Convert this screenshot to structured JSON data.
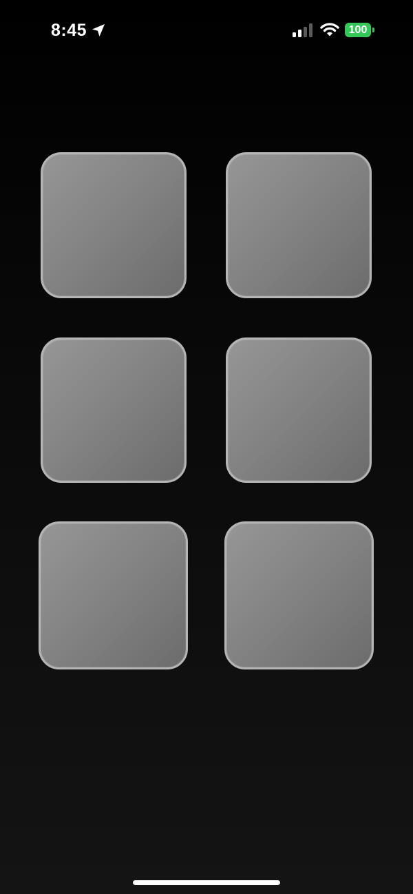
{
  "status_bar": {
    "time": "8:45",
    "battery_level": "100",
    "icons": [
      "location-arrow-icon",
      "cellular-signal-icon",
      "wifi-icon",
      "battery-icon"
    ],
    "battery_color": "#34c759"
  },
  "grid": {
    "tiles": [
      {
        "id": "tile-1"
      },
      {
        "id": "tile-2"
      },
      {
        "id": "tile-3"
      },
      {
        "id": "tile-4"
      },
      {
        "id": "tile-5"
      },
      {
        "id": "tile-6"
      }
    ]
  },
  "colors": {
    "background": "#000000",
    "tile_fill": "#858585",
    "tile_border": "#b5b5b5",
    "home_indicator": "#ffffff"
  }
}
